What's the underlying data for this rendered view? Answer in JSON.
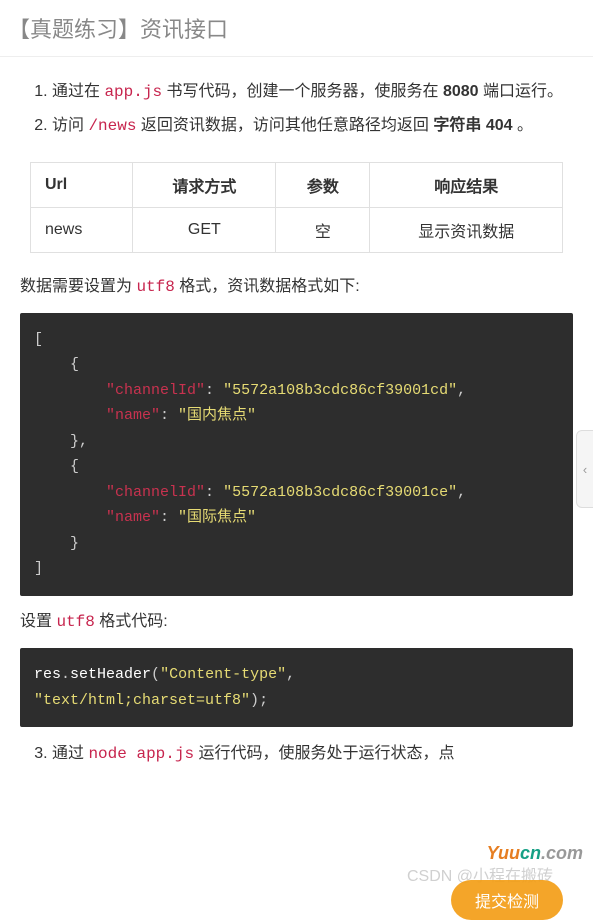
{
  "header": {
    "title": "【真题练习】资讯接口"
  },
  "steps": {
    "item1": {
      "pre": "通过在 ",
      "code": "app.js",
      "mid": " 书写代码，创建一个服务器，使服务在 ",
      "bold": "8080",
      "post": " 端口运行。"
    },
    "item2": {
      "pre": "访问 ",
      "code": "/news",
      "mid": " 返回资讯数据，访问其他任意路径均返回 ",
      "bold": "字符串 404",
      "post": " 。"
    },
    "item3": {
      "pre": "通过 ",
      "code": "node app.js",
      "post": " 运行代码，使服务处于运行状态，点"
    }
  },
  "table": {
    "headers": {
      "c1": "Url",
      "c2": "请求方式",
      "c3": "参数",
      "c4": "响应结果"
    },
    "row": {
      "c1": "news",
      "c2": "GET",
      "c3": "空",
      "c4": "显示资讯数据"
    }
  },
  "para1": {
    "pre": "数据需要设置为 ",
    "code": "utf8",
    "post": " 格式，资讯数据格式如下:"
  },
  "json_block": {
    "key_channelId": "\"channelId\"",
    "val1": "\"5572a108b3cdc86cf39001cd\"",
    "key_name": "\"name\"",
    "val_name1": "\"国内焦点\"",
    "val2": "\"5572a108b3cdc86cf39001ce\"",
    "val_name2": "\"国际焦点\""
  },
  "para2": {
    "pre": "设置 ",
    "code": "utf8",
    "post": " 格式代码:"
  },
  "code2": {
    "obj": "res",
    "dot": ".",
    "method": "setHeader",
    "arg1": "\"Content-type\"",
    "arg2": "\"text/html;charset=utf8\""
  },
  "button": {
    "submit": "提交检测"
  },
  "watermark": {
    "csdn": "CSDN @小程在搬砖",
    "yuucn": "Yuucn.com"
  },
  "side": {
    "chevron": "‹"
  }
}
